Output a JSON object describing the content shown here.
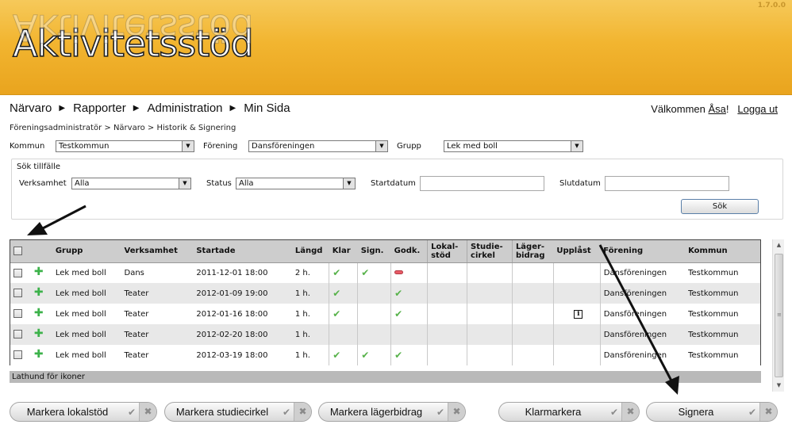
{
  "app": {
    "version": "1.7.0.0",
    "logo_text": "Aktivitetsstöd"
  },
  "nav": {
    "items": [
      {
        "label": "Närvaro"
      },
      {
        "label": "Rapporter"
      },
      {
        "label": "Administration"
      },
      {
        "label": "Min Sida"
      }
    ],
    "welcome_text": "Välkommen",
    "user_name": "Åsa",
    "welcome_suffix": "!",
    "logout_label": "Logga ut"
  },
  "breadcrumb": "Föreningsadministratör > Närvaro > Historik & Signering",
  "filters": {
    "kommun_label": "Kommun",
    "kommun_value": "Testkommun",
    "forening_label": "Förening",
    "forening_value": "Dansföreningen",
    "grupp_label": "Grupp",
    "grupp_value": "Lek med boll"
  },
  "search": {
    "legend": "Sök tillfälle",
    "verksamhet_label": "Verksamhet",
    "verksamhet_value": "Alla",
    "status_label": "Status",
    "status_value": "Alla",
    "startdatum_label": "Startdatum",
    "startdatum_value": "",
    "slutdatum_label": "Slutdatum",
    "slutdatum_value": "",
    "button_label": "Sök"
  },
  "table": {
    "columns": {
      "grupp": "Grupp",
      "verksamhet": "Verksamhet",
      "startade": "Startade",
      "langd": "Längd",
      "klar": "Klar",
      "sign": "Sign.",
      "godk": "Godk.",
      "lokalstod_1": "Lokal-",
      "lokalstod_2": "stöd",
      "studiecirkel_1": "Studie-",
      "studiecirkel_2": "cirkel",
      "lagerbidrag_1": "Läger-",
      "lagerbidrag_2": "bidrag",
      "upplast": "Upplåst",
      "forening": "Förening",
      "kommun": "Kommun"
    },
    "rows": [
      {
        "grupp": "Lek med boll",
        "verksamhet": "Dans",
        "startade": "2011-12-01 18:00",
        "langd": "2 h.",
        "klar": "check",
        "sign": "check",
        "godk": "minus",
        "upplast": "",
        "forening": "Dansföreningen",
        "kommun": "Testkommun"
      },
      {
        "grupp": "Lek med boll",
        "verksamhet": "Teater",
        "startade": "2012-01-09 19:00",
        "langd": "1 h.",
        "klar": "check",
        "sign": "",
        "godk": "check",
        "upplast": "",
        "forening": "Dansföreningen",
        "kommun": "Testkommun"
      },
      {
        "grupp": "Lek med boll",
        "verksamhet": "Teater",
        "startade": "2012-01-16 18:00",
        "langd": "1 h.",
        "klar": "check",
        "sign": "",
        "godk": "check",
        "upplast": "info",
        "forening": "Dansföreningen",
        "kommun": "Testkommun"
      },
      {
        "grupp": "Lek med boll",
        "verksamhet": "Teater",
        "startade": "2012-02-20 18:00",
        "langd": "1 h.",
        "klar": "",
        "sign": "",
        "godk": "",
        "upplast": "",
        "forening": "Dansföreningen",
        "kommun": "Testkommun"
      },
      {
        "grupp": "Lek med boll",
        "verksamhet": "Teater",
        "startade": "2012-03-19 18:00",
        "langd": "1 h.",
        "klar": "check",
        "sign": "check",
        "godk": "check",
        "upplast": "",
        "forening": "Dansföreningen",
        "kommun": "Testkommun"
      }
    ],
    "footer_label": "Lathund för ikoner"
  },
  "buttons": {
    "lokalstod": "Markera lokalstöd",
    "studiecirkel": "Markera studiecirkel",
    "lagerbidrag": "Markera lägerbidrag",
    "klarmarkera": "Klarmarkera",
    "signera": "Signera"
  },
  "icons": {
    "dropdown": "chevron-down-icon",
    "row_add": "plus-icon",
    "status_ok": "check-icon",
    "status_rejected": "minus-icon",
    "upplast_info": "info-icon"
  },
  "colors": {
    "banner": "#f2b530",
    "check": "#57b24a",
    "plus": "#3cb24a",
    "minus": "#e85b66",
    "header_row": "#cdcdcd"
  }
}
